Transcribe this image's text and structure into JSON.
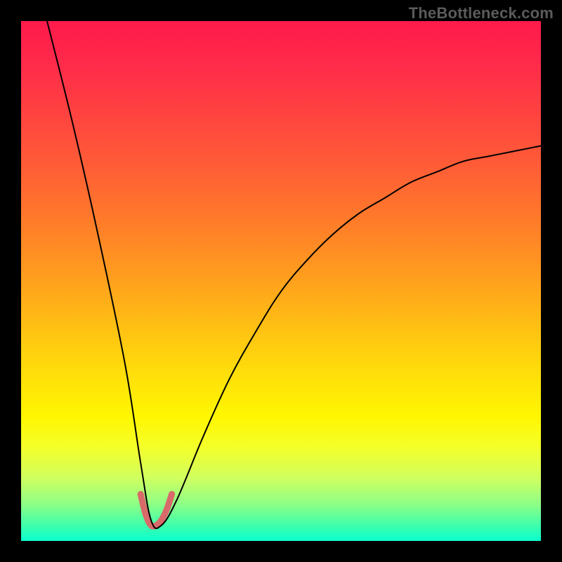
{
  "watermark": "TheBottleneck.com",
  "chart_data": {
    "type": "line",
    "title": "",
    "xlabel": "",
    "ylabel": "",
    "xlim": [
      0,
      100
    ],
    "ylim": [
      0,
      100
    ],
    "series": [
      {
        "name": "main-curve",
        "color": "#000000",
        "stroke_width": 2,
        "x": [
          5,
          10,
          15,
          20,
          23,
          25,
          27,
          30,
          35,
          40,
          45,
          50,
          55,
          60,
          65,
          70,
          75,
          80,
          85,
          90,
          95,
          100
        ],
        "values": [
          100,
          80,
          58,
          34,
          15,
          4,
          3,
          8,
          20,
          31,
          40,
          48,
          54,
          59,
          63,
          66,
          69,
          71,
          73,
          74,
          75,
          76
        ]
      },
      {
        "name": "highlight-bottom",
        "color": "#d86a6a",
        "stroke_width": 9,
        "x": [
          23,
          24,
          25,
          26,
          27,
          28,
          29
        ],
        "values": [
          9,
          5,
          3,
          3,
          4,
          6,
          9
        ]
      }
    ],
    "gradient_stops": [
      {
        "pct": 0,
        "color": "#ff1a4b"
      },
      {
        "pct": 20,
        "color": "#ff5030"
      },
      {
        "pct": 50,
        "color": "#ffb015"
      },
      {
        "pct": 75,
        "color": "#fff600"
      },
      {
        "pct": 90,
        "color": "#a0ff70"
      },
      {
        "pct": 100,
        "color": "#0affd0"
      }
    ]
  }
}
